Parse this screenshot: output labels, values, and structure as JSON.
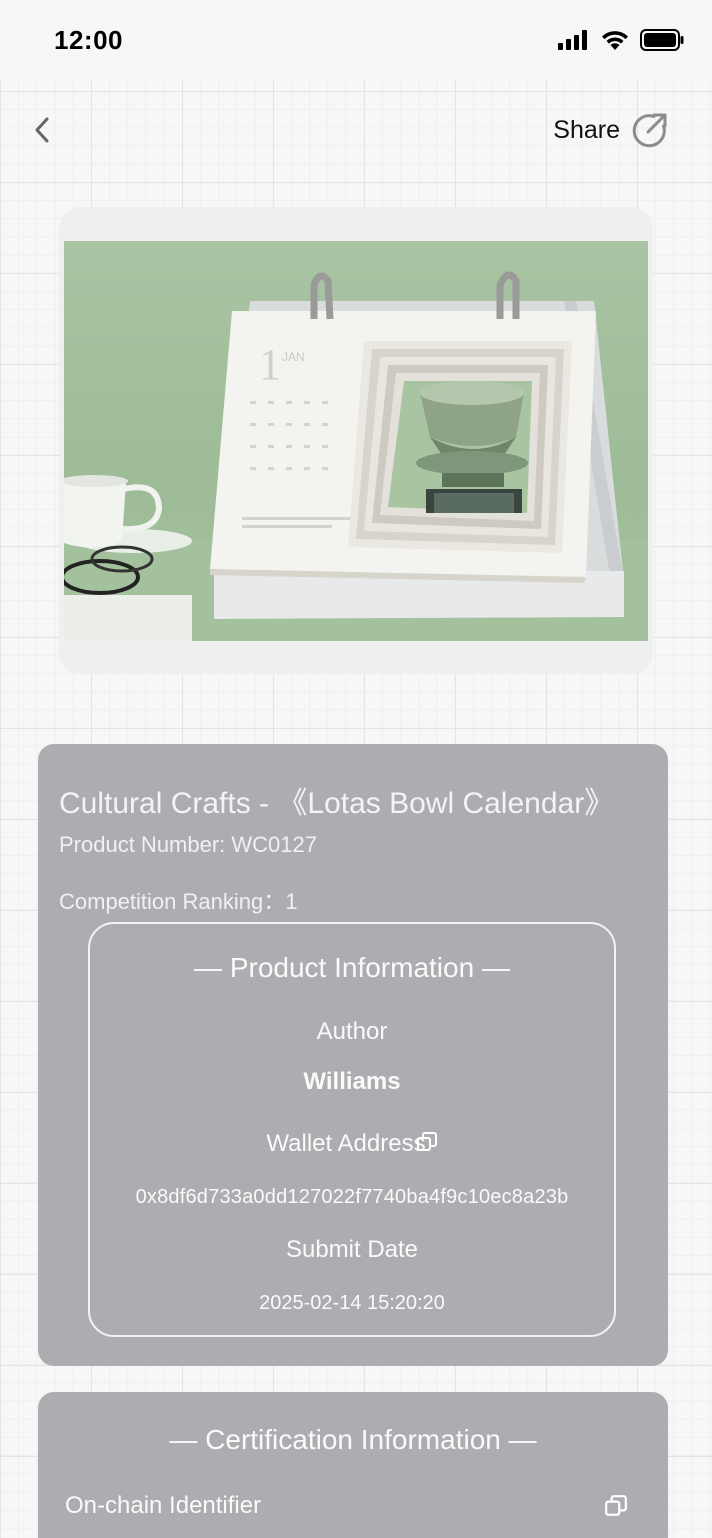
{
  "status": {
    "time": "12:00"
  },
  "nav": {
    "share_label": "Share"
  },
  "product": {
    "title": "Cultural Crafts - 《Lotas Bowl Calendar》",
    "number_label": "Product Number: ",
    "number_value": "WC0127",
    "ranking_label": "Competition Ranking：",
    "ranking_value": "1"
  },
  "product_info": {
    "section_title": "— Product Information —",
    "author_label": "Author",
    "author_value": "Williams",
    "wallet_label": "Wallet Address",
    "wallet_value": "0x8df6d733a0dd127022f7740ba4f9c10ec8a23b",
    "submit_label": "Submit Date",
    "submit_value": "2025-02-14 15:20:20"
  },
  "certification": {
    "section_title": "— Certification Information —",
    "identifier_label": "On-chain Identifier"
  },
  "icons": {
    "back": "chevron-left-icon",
    "share": "share-arrow-icon",
    "copy": "copy-icon"
  },
  "colors": {
    "card_bg": "#adacb0",
    "card_text": "#ffffff",
    "page_bg": "#f7f7f7"
  }
}
